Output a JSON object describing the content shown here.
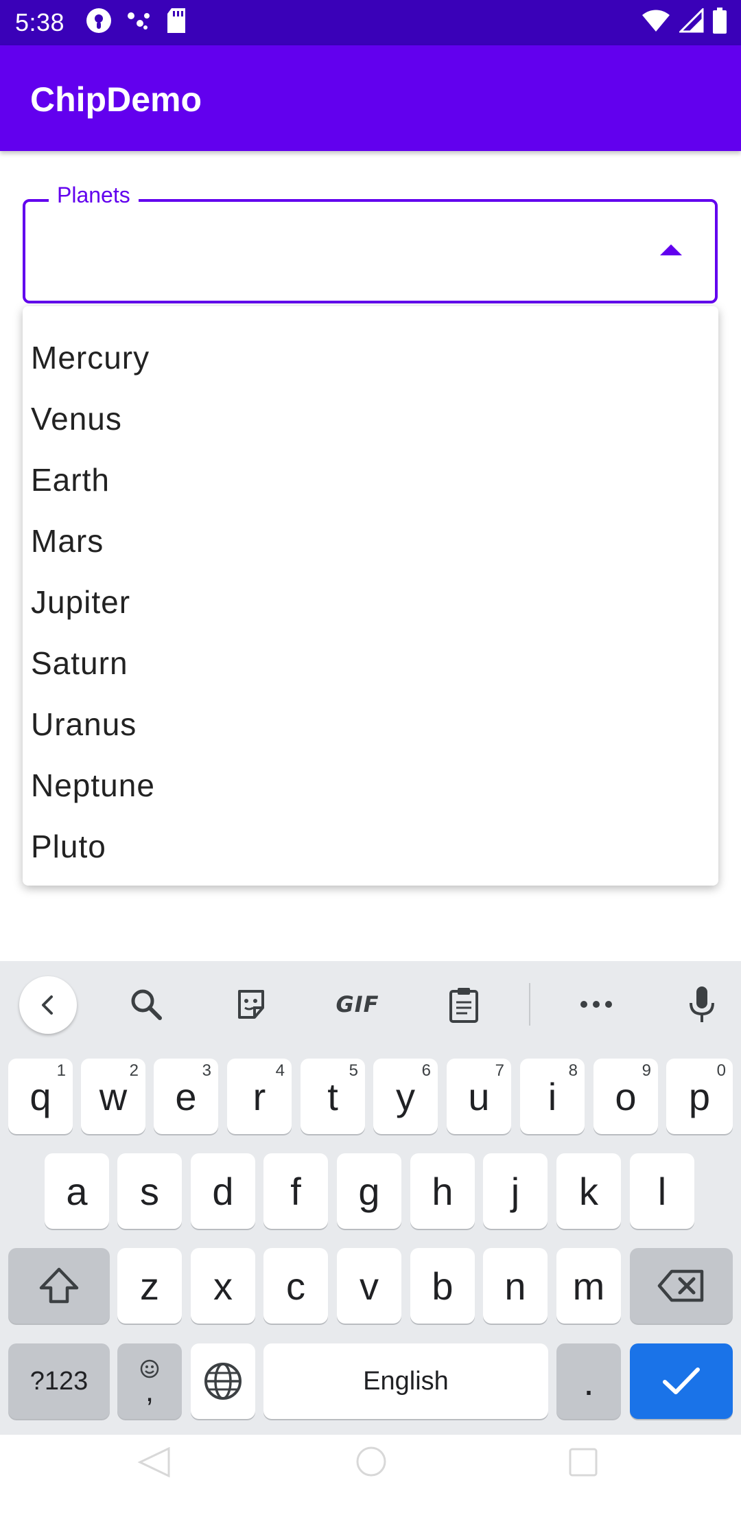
{
  "status_bar": {
    "time": "5:38",
    "left_icons": [
      "podcast-icon",
      "dots-icon",
      "sd-card-icon"
    ],
    "right_icons": [
      "wifi-icon",
      "signal-icon",
      "battery-icon"
    ]
  },
  "app_bar": {
    "title": "ChipDemo"
  },
  "planets_field": {
    "label": "Planets",
    "value": "",
    "expanded": true
  },
  "menu": {
    "items": [
      "Mercury",
      "Venus",
      "Earth",
      "Mars",
      "Jupiter",
      "Saturn",
      "Uranus",
      "Neptune",
      "Pluto"
    ]
  },
  "keyboard": {
    "toolbar_icons": [
      "back-icon",
      "search-icon",
      "sticker-icon",
      "gif-icon",
      "clipboard-icon",
      "more-icon",
      "mic-icon"
    ],
    "gif_label": "GIF",
    "row1": [
      {
        "key": "q",
        "hint": "1"
      },
      {
        "key": "w",
        "hint": "2"
      },
      {
        "key": "e",
        "hint": "3"
      },
      {
        "key": "r",
        "hint": "4"
      },
      {
        "key": "t",
        "hint": "5"
      },
      {
        "key": "y",
        "hint": "6"
      },
      {
        "key": "u",
        "hint": "7"
      },
      {
        "key": "i",
        "hint": "8"
      },
      {
        "key": "o",
        "hint": "9"
      },
      {
        "key": "p",
        "hint": "0"
      }
    ],
    "row2": [
      "a",
      "s",
      "d",
      "f",
      "g",
      "h",
      "j",
      "k",
      "l"
    ],
    "row3": [
      "z",
      "x",
      "c",
      "v",
      "b",
      "n",
      "m"
    ],
    "symbols_label": "?123",
    "emoji_comma_label": ",",
    "space_label": "English",
    "period_label": "."
  },
  "colors": {
    "primary": "#6200ee",
    "status_bar": "#3a01b8",
    "enter_key": "#1a73e8"
  }
}
